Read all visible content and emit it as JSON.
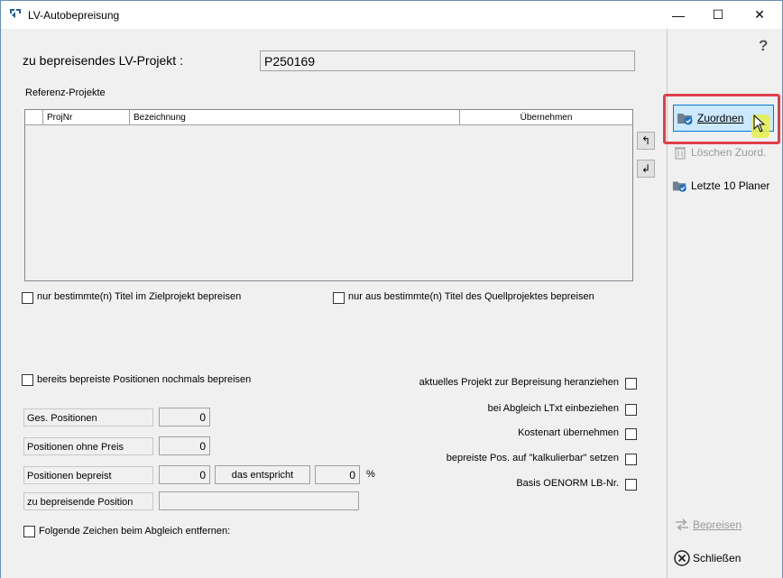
{
  "window": {
    "title": "LV-Autobepreisung",
    "minimize_glyph": "—",
    "maximize_glyph": "☐",
    "close_glyph": "✕"
  },
  "header": {
    "project_label": "zu bepreisendes LV-Projekt :",
    "project_value": "P250169",
    "help_glyph": "?"
  },
  "reference": {
    "section_label": "Referenz-Projekte",
    "columns": [
      "",
      "ProjNr",
      "Bezeichnung",
      "Übernehmen"
    ],
    "rows": []
  },
  "move_buttons": {
    "up": "↰",
    "down": "↲"
  },
  "filters": {
    "title_target": "nur bestimmte(n) Titel im Zielprojekt bepreisen",
    "title_source": "nur aus bestimmte(n) Titel des Quellprojektes bepreisen",
    "reprice": "bereits bepreiste Positionen nochmals bepreisen"
  },
  "options": [
    "aktuelles Projekt zur Bepreisung heranziehen",
    "bei Abgleich LTxt einbeziehen",
    "Kostenart übernehmen",
    "bepreiste Pos. auf \"kalkulierbar\" setzen",
    "Basis OENORM LB-Nr."
  ],
  "stats": {
    "total_label": "Ges. Positionen",
    "total_value": "0",
    "no_price_label": "Positionen ohne Preis",
    "no_price_value": "0",
    "priced_label": "Positionen bepreist",
    "priced_value": "0",
    "equivalent_label": "das entspricht",
    "percent_value": "0",
    "percent_unit": "%",
    "current_label": "zu bepreisende Position",
    "current_value": ""
  },
  "remove_chars_label": "Folgende Zeichen beim Abgleich entfernen:",
  "sidebar": {
    "assign": "Zuordnen",
    "delete_assign": "Löschen Zuord.",
    "last_planners": "Letzte 10 Planer",
    "price": "Bepreisen",
    "close": "Schließen"
  },
  "colors": {
    "accent": "#0078d7",
    "highlight_border": "#e0404a",
    "selected_bg": "#cce8ff",
    "disabled_text": "#9a9a9a"
  }
}
